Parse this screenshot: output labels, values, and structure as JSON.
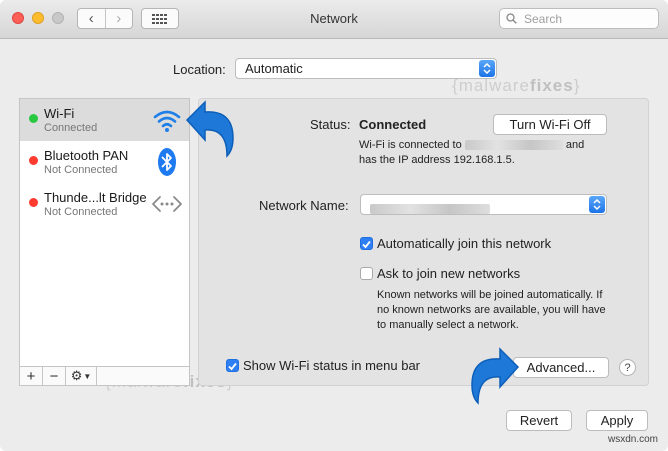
{
  "window": {
    "title": "Network",
    "search_placeholder": "Search"
  },
  "location": {
    "label": "Location:",
    "value": "Automatic"
  },
  "services": [
    {
      "name": "Wi-Fi",
      "status": "Connected",
      "dot": "#28c840",
      "icon": "wifi-icon",
      "selected": true
    },
    {
      "name": "Bluetooth PAN",
      "status": "Not Connected",
      "dot": "#ff3b30",
      "icon": "bluetooth-icon",
      "selected": false
    },
    {
      "name": "Thunde...lt Bridge",
      "status": "Not Connected",
      "dot": "#ff3b30",
      "icon": "thunderbolt-bridge-icon",
      "selected": false
    }
  ],
  "sidebar_tools": {
    "add": "+",
    "remove": "−",
    "gear": "⚙"
  },
  "detail": {
    "status_label": "Status:",
    "status_value": "Connected",
    "turn_off_button": "Turn Wi-Fi Off",
    "desc_line1_prefix": "Wi-Fi is connected to",
    "desc_line1_suffix": "and",
    "desc_line2": "has the IP address 192.168.1.5.",
    "network_name_label": "Network Name:",
    "auto_join_label": "Automatically join this network",
    "auto_join_checked": true,
    "ask_join_label": "Ask to join new networks",
    "ask_join_checked": false,
    "ask_join_note_1": "Known networks will be joined automatically. If",
    "ask_join_note_2": "no known networks are available, you will have",
    "ask_join_note_3": "to manually select a network."
  },
  "bottom": {
    "show_status_label": "Show Wi-Fi status in menu bar",
    "show_status_checked": true,
    "advanced_button": "Advanced...",
    "help_button": "?",
    "revert_button": "Revert",
    "apply_button": "Apply"
  },
  "watermark": {
    "open": "{",
    "part1": "malware",
    "part2": "fixes",
    "close": "}"
  },
  "credit": "wsxdn.com",
  "colors": {
    "accent": "#2f7ff4",
    "arrow": "#1e78d8"
  }
}
